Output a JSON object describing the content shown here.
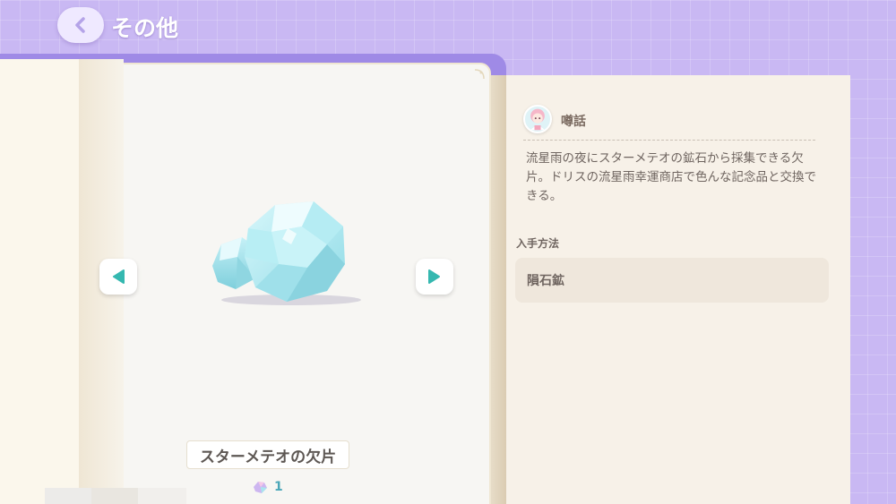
{
  "header": {
    "title": "その他",
    "back_icon": "chevron-left-icon"
  },
  "item": {
    "name": "スターメテオの欠片",
    "count": "1",
    "image": "crystal-icon",
    "count_icon": "gem-icon"
  },
  "navigation": {
    "prev_icon": "triangle-left-icon",
    "next_icon": "triangle-right-icon"
  },
  "info": {
    "rumor_heading": "噂話",
    "description": "流星雨の夜にスターメテオの鉱石から採集できる欠片。ドリスの流星雨幸運商店で色んな記念品と交換できる。",
    "acquire_heading": "入手方法",
    "acquire_method": "隕石鉱"
  },
  "colors": {
    "background": "#c9b8f3",
    "accent_teal": "#35b8b0",
    "panel": "#f7f1e8"
  }
}
